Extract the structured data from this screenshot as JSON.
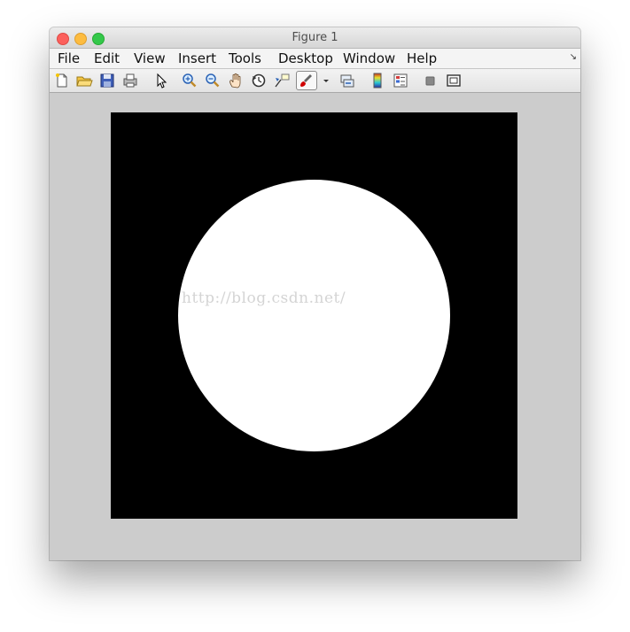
{
  "window": {
    "title": "Figure 1"
  },
  "menubar": {
    "items": [
      {
        "id": "file",
        "label": "File"
      },
      {
        "id": "edit",
        "label": "Edit"
      },
      {
        "id": "view",
        "label": "View"
      },
      {
        "id": "insert",
        "label": "Insert"
      },
      {
        "id": "tools",
        "label": "Tools"
      },
      {
        "id": "desktop",
        "label": "Desktop"
      },
      {
        "id": "window",
        "label": "Window"
      },
      {
        "id": "help",
        "label": "Help"
      }
    ]
  },
  "toolbar": {
    "buttons": [
      {
        "id": "new",
        "icon": "new-figure-icon"
      },
      {
        "id": "open",
        "icon": "open-folder-icon"
      },
      {
        "id": "save",
        "icon": "save-icon"
      },
      {
        "id": "print",
        "icon": "print-icon"
      },
      {
        "id": "edit-plot",
        "icon": "arrow-pointer-icon"
      },
      {
        "id": "zoom-in",
        "icon": "zoom-in-icon"
      },
      {
        "id": "zoom-out",
        "icon": "zoom-out-icon"
      },
      {
        "id": "pan",
        "icon": "pan-hand-icon"
      },
      {
        "id": "rotate",
        "icon": "rotate-3d-icon"
      },
      {
        "id": "data-cursor",
        "icon": "data-cursor-icon"
      },
      {
        "id": "brush",
        "icon": "brush-icon"
      },
      {
        "id": "link",
        "icon": "link-plot-icon"
      },
      {
        "id": "colorbar",
        "icon": "colorbar-icon"
      },
      {
        "id": "legend",
        "icon": "legend-icon"
      },
      {
        "id": "hide-tools",
        "icon": "hide-plot-tools-icon"
      },
      {
        "id": "show-tools",
        "icon": "show-plot-tools-icon"
      }
    ]
  },
  "image": {
    "background_color": "#000000",
    "disc_color": "#ffffff",
    "watermark": "http://blog.csdn.net/"
  },
  "colors": {
    "close": "#fc605c",
    "minimize": "#fdbc40",
    "maximize": "#34c84a",
    "figure_background": "#cccccc"
  }
}
